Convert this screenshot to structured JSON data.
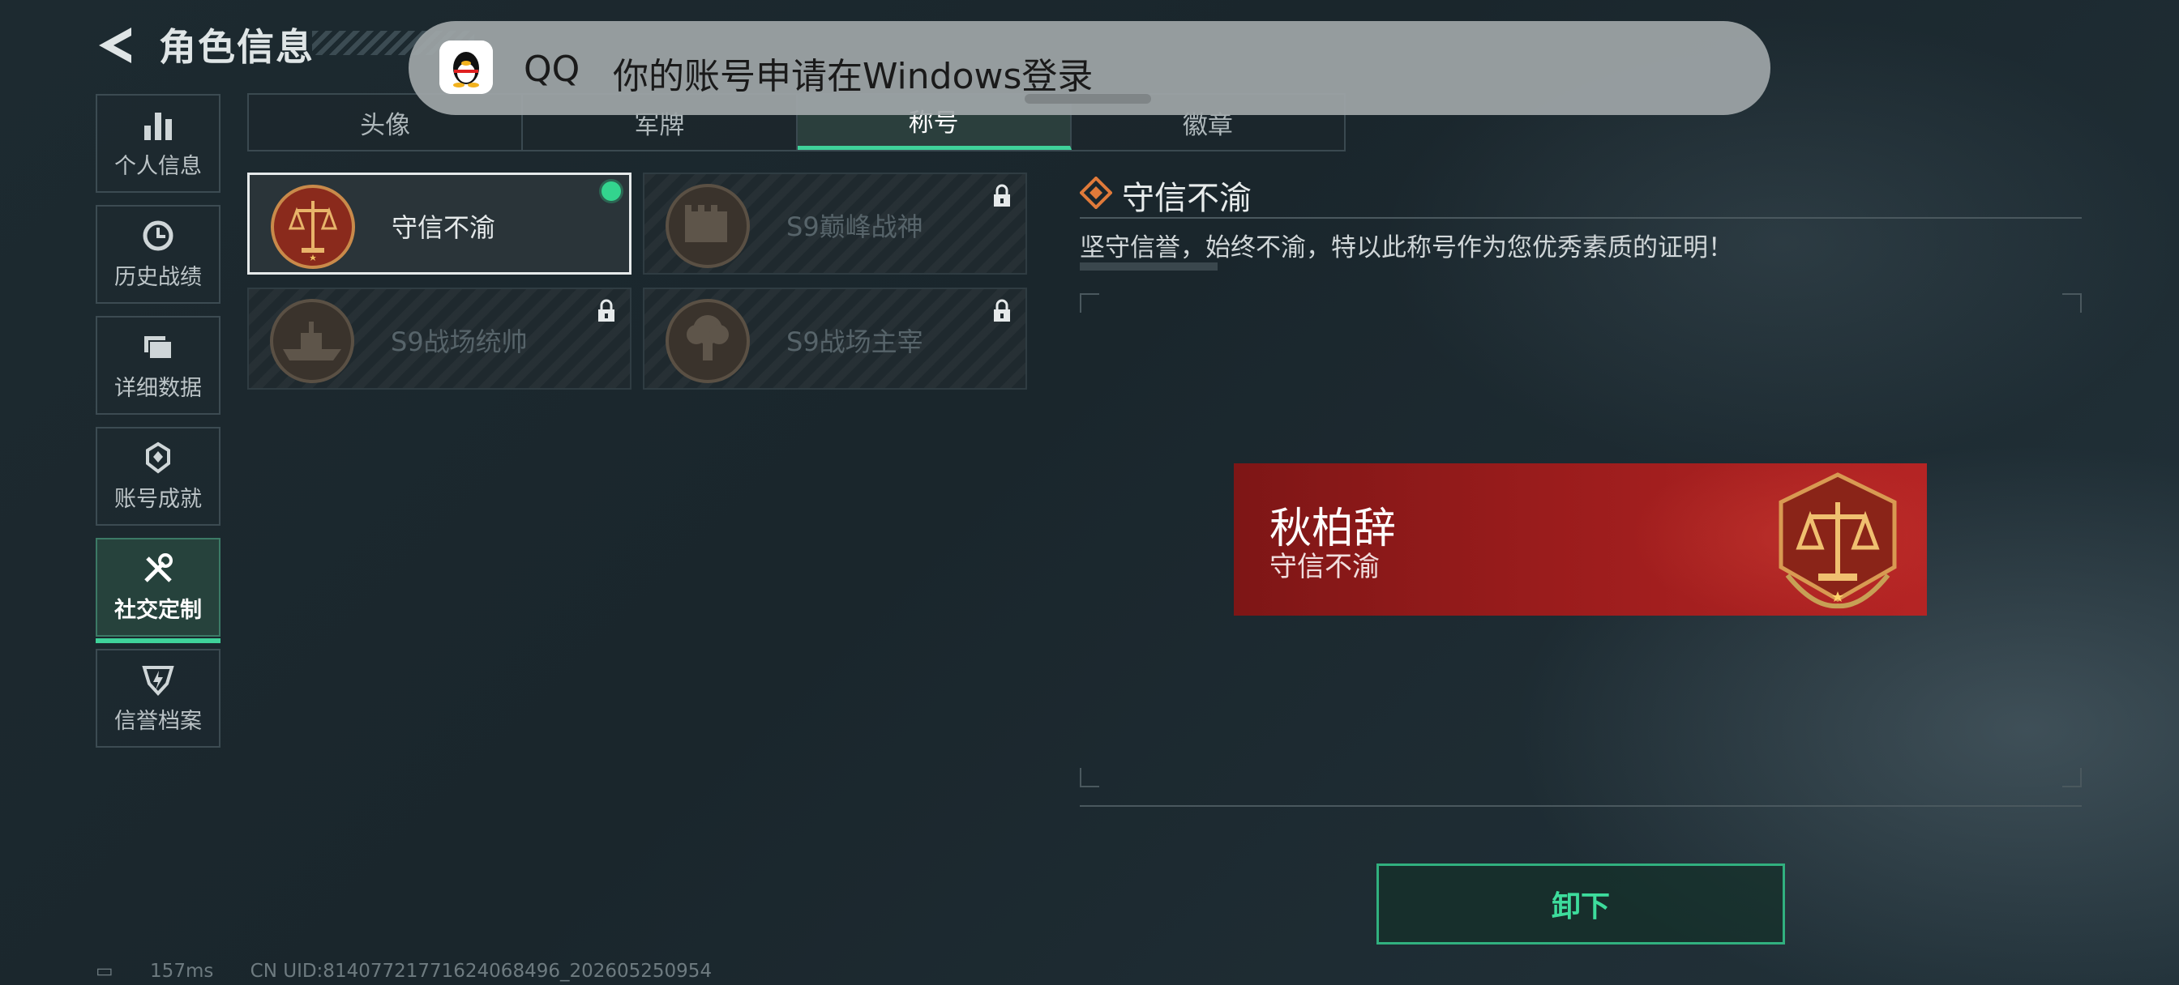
{
  "header": {
    "title": "角色信息",
    "back_icon": "back-arrow-icon"
  },
  "sidebar": {
    "items": [
      {
        "label": "个人信息",
        "icon": "bar-chart-icon",
        "active": false
      },
      {
        "label": "历史战绩",
        "icon": "history-icon",
        "active": false
      },
      {
        "label": "详细数据",
        "icon": "folder-icon",
        "active": false
      },
      {
        "label": "账号成就",
        "icon": "achievement-icon",
        "active": false
      },
      {
        "label": "社交定制",
        "icon": "tools-icon",
        "active": true
      },
      {
        "label": "信誉档案",
        "icon": "credit-icon",
        "active": false
      }
    ]
  },
  "tabs": [
    {
      "label": "头像",
      "active": false
    },
    {
      "label": "军牌",
      "active": false
    },
    {
      "label": "称号",
      "active": true
    },
    {
      "label": "徽章",
      "active": false
    }
  ],
  "titles": [
    {
      "name": "守信不渝",
      "selected": true,
      "equipped": true,
      "locked": false
    },
    {
      "name": "S9巅峰战神",
      "selected": false,
      "equipped": false,
      "locked": true
    },
    {
      "name": "S9战场统帅",
      "selected": false,
      "equipped": false,
      "locked": true
    },
    {
      "name": "S9战场主宰",
      "selected": false,
      "equipped": false,
      "locked": true
    }
  ],
  "detail": {
    "title": "守信不渝",
    "description": "坚守信誉，始终不渝，特以此称号作为您优秀素质的证明！",
    "preview": {
      "player_name": "秋柏辞",
      "title": "守信不渝"
    },
    "action_label": "卸下"
  },
  "status": {
    "ping": "157ms",
    "uid": "CN UID:8140772177162406849​6_202605250954"
  },
  "notification": {
    "app": "QQ",
    "message": "你的账号申请在Windows登录"
  },
  "colors": {
    "accent": "#3fd29a",
    "banner_red": "#9a1c1c",
    "equipped_dot": "#33d48e"
  }
}
